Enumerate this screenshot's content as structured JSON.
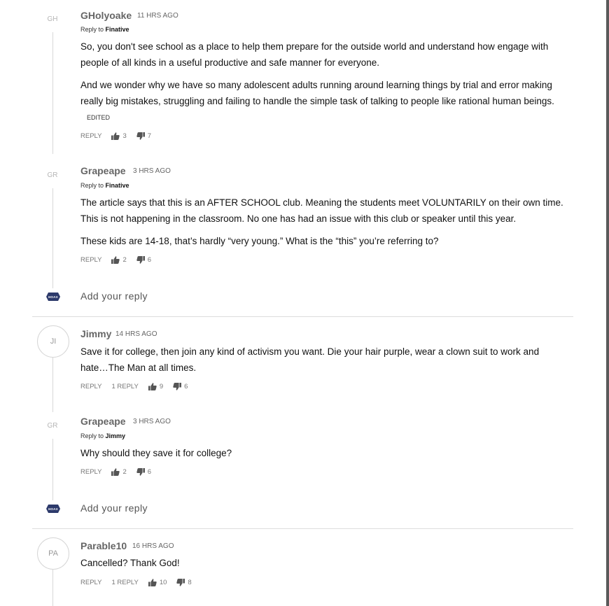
{
  "labels": {
    "reply": "REPLY",
    "reply_to": "Reply to",
    "edited": "EDITED",
    "add_reply_placeholder": "Add your reply",
    "hoax_badge": "HOAX"
  },
  "threads": [
    {
      "replies": [
        {
          "initials": "GH",
          "author": "GHolyoake",
          "time": "11 HRS AGO",
          "reply_to": "Finative",
          "paragraphs": [
            "So, you don't see school as a place to help them prepare for the outside world and understand how engage with people of all kinds in a useful productive and safe manner for everyone.",
            "And we wonder why we have so many adolescent adults running around learning things by trial and error making really big mistakes, struggling and failing to handle the simple task of talking to people like rational human beings."
          ],
          "edited": true,
          "likes": "3",
          "dislikes": "7"
        },
        {
          "initials": "GR",
          "author": "Grapeape",
          "time": "3 HRS AGO",
          "reply_to": "Finative",
          "paragraphs": [
            "The article says that this is an AFTER SCHOOL club. Meaning the students meet VOLUNTARILY on their own time. This is not happening in the classroom. No one has had an issue with this club or speaker until this year.",
            "These kids are 14-18, that’s hardly “very young.” What is the “this” you’re referring to?"
          ],
          "likes": "2",
          "dislikes": "6"
        }
      ]
    },
    {
      "top": {
        "initials": "JI",
        "author": "Jimmy",
        "time": "14 HRS AGO",
        "text": "Save it for college, then join any kind of activism you want. Die your hair purple, wear a clown suit to work and hate…The Man at all times.",
        "reply_count": "1 REPLY",
        "likes": "9",
        "dislikes": "6"
      },
      "replies": [
        {
          "initials": "GR",
          "author": "Grapeape",
          "time": "3 HRS AGO",
          "reply_to": "Jimmy",
          "text": "Why should they save it for college?",
          "likes": "2",
          "dislikes": "6"
        }
      ]
    },
    {
      "top": {
        "initials": "PA",
        "author": "Parable10",
        "time": "16 HRS AGO",
        "text": "Cancelled? Thank God!",
        "reply_count": "1 REPLY",
        "likes": "10",
        "dislikes": "8"
      }
    }
  ]
}
